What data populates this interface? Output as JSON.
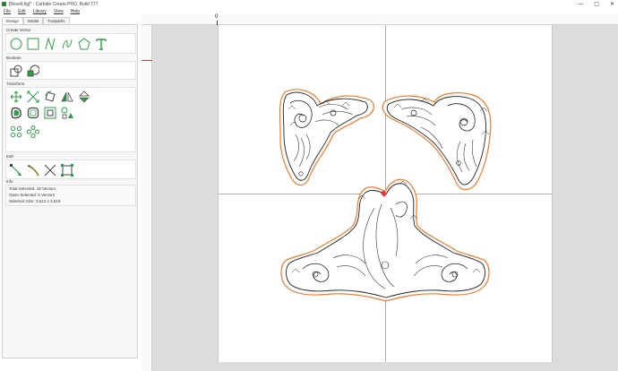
{
  "window": {
    "title": "[Revell.fig]* - Carbide Create PRO, Build 777",
    "controls": {
      "minimize": "—",
      "maximize": "▢",
      "close": "✕"
    }
  },
  "menu": {
    "file": "File",
    "edit": "Edit",
    "library": "Library",
    "view": "View",
    "help": "Help"
  },
  "tabs": {
    "design": "Design",
    "model": "Model",
    "toolpaths": "Toolpaths"
  },
  "panel": {
    "create_vector": {
      "title": "Create Vector"
    },
    "boolean": {
      "title": "Boolean"
    },
    "transform": {
      "title": "Transform"
    },
    "edit": {
      "title": "Edit"
    },
    "info": {
      "title": "Info",
      "total_selected": "Total Selected:   18 Vectors",
      "open_selected": "Open Selected:   0 Vectors",
      "selected_size": "Selected Size:   3.612 x 3.619"
    }
  },
  "ruler": {
    "zero_label": "0"
  },
  "colors": {
    "accent": "#2e9e45",
    "toolpath_outline": "#f07a2b",
    "selection_marker": "#e53935",
    "stock": "#ffffff"
  }
}
